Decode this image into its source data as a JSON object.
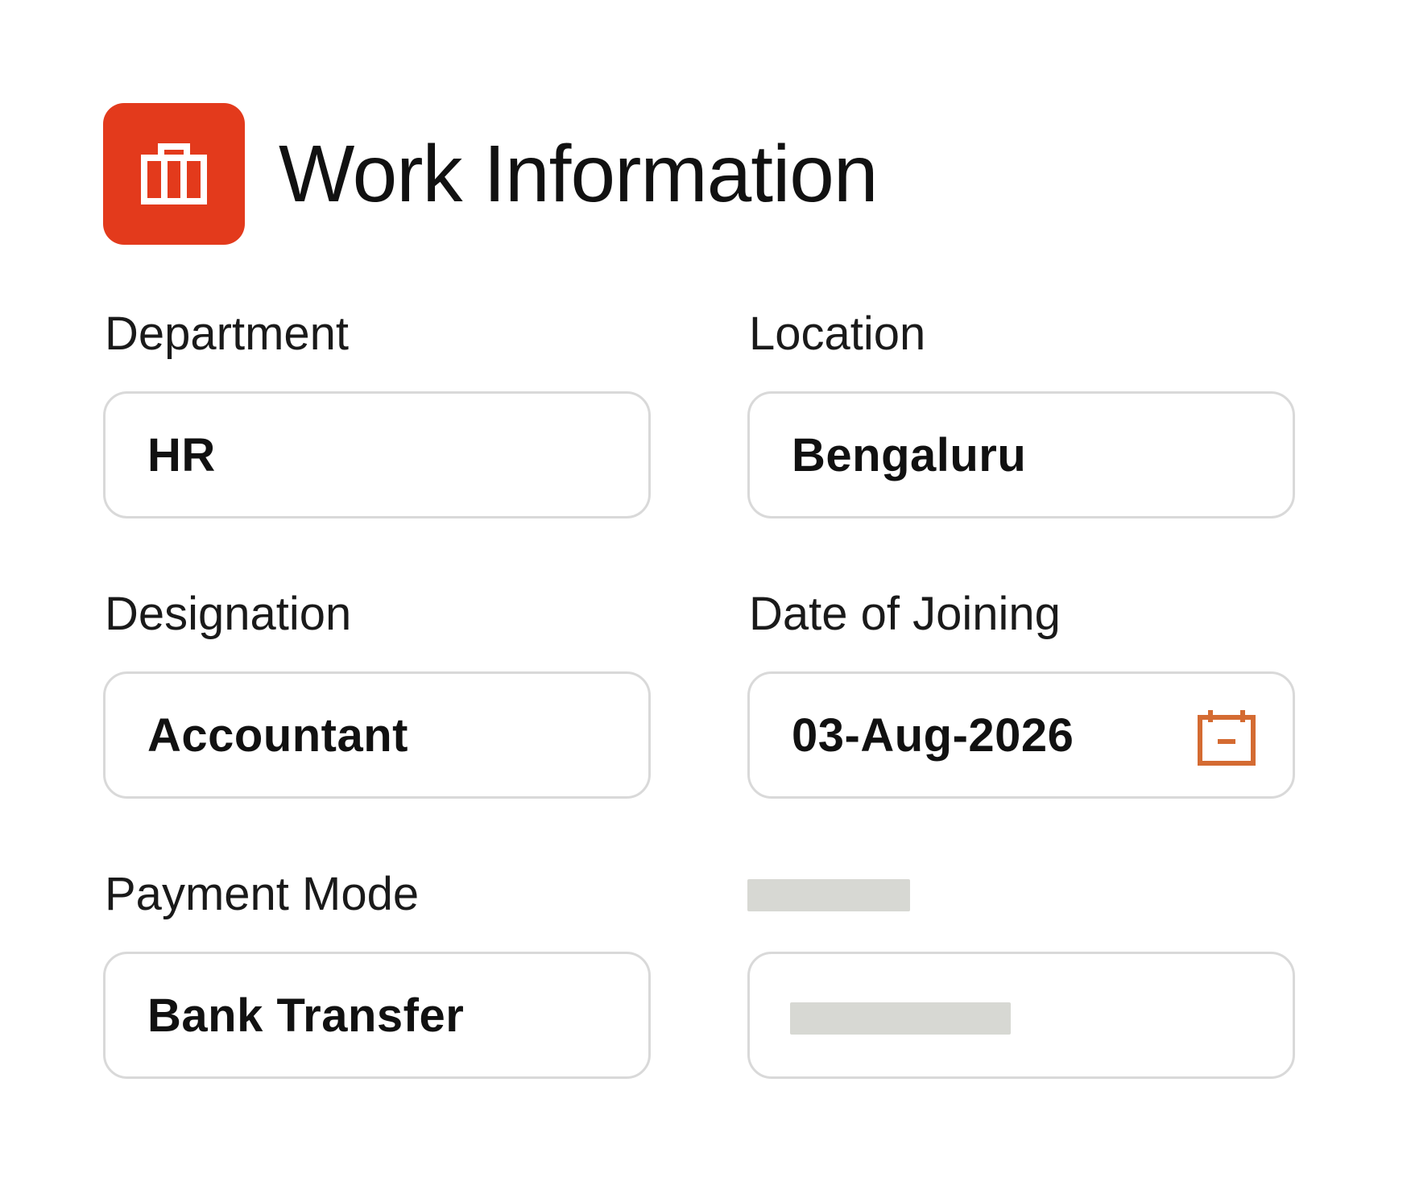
{
  "header": {
    "title": "Work Information",
    "icon": "briefcase-icon",
    "accent_color": "#e33a1c"
  },
  "form": {
    "department": {
      "label": "Department",
      "value": "HR"
    },
    "location": {
      "label": "Location",
      "value": "Bengaluru"
    },
    "designation": {
      "label": "Designation",
      "value": "Accountant"
    },
    "date_of_joining": {
      "label": "Date of Joining",
      "value": "03-Aug-2026",
      "icon": "calendar-icon",
      "icon_color": "#d46b32"
    },
    "payment_mode": {
      "label": "Payment Mode",
      "value": "Bank Transfer"
    }
  },
  "colors": {
    "field_border": "#d9d9d9",
    "placeholder": "#d7d8d3"
  }
}
